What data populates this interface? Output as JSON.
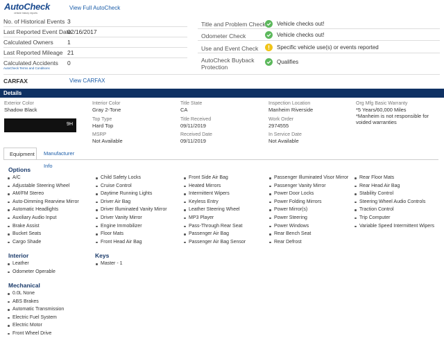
{
  "colors": {
    "accent": "#1a5ca8",
    "details_bar": "#0f3163",
    "check_green": "#5cb85c",
    "check_yellow": "#f0c419"
  },
  "autocheck": {
    "logo_text": "AutoCheck",
    "logo_sub": "vehicle history reports",
    "view_full": "View Full AutoCheck",
    "stats": [
      {
        "label": "No. of Historical Events",
        "value": "3"
      },
      {
        "label": "Last Reported Event Date",
        "value": "02/16/2017"
      },
      {
        "label": "Calculated Owners",
        "value": "1"
      },
      {
        "label": "Last Reported Mileage",
        "value": "21"
      },
      {
        "label": "Calculated Accidents",
        "value": "0"
      }
    ],
    "terms": "AutoCheck Terms and Conditions",
    "checks": [
      {
        "label": "Title and Problem Check",
        "status": "green",
        "icon": "check-circle-icon",
        "text": "Vehicle checks out!"
      },
      {
        "label": "Odometer Check",
        "status": "green",
        "icon": "check-circle-icon",
        "text": "Vehicle checks out!"
      },
      {
        "label": "Use and Event Check",
        "status": "yellow",
        "icon": "alert-circle-icon",
        "text": "Specific vehicle use(s) or events reported"
      },
      {
        "label": "AutoCheck Buyback Protection",
        "status": "green",
        "icon": "check-circle-icon",
        "text": "Qualifies"
      }
    ]
  },
  "carfax": {
    "label": "CARFAX",
    "view_link": "View CARFAX"
  },
  "details": {
    "title": "Details",
    "exterior_color": {
      "label": "Exterior Color",
      "value": "Shadow Black"
    },
    "interior_color": {
      "label": "Interior Color",
      "value": "Gray 2-Tone"
    },
    "top_type": {
      "label": "Top Type",
      "value": "Hard Top"
    },
    "msrp": {
      "label": "MSRP",
      "value": "Not Available"
    },
    "title_state": {
      "label": "Title State",
      "value": "CA"
    },
    "title_received": {
      "label": "Title Received",
      "value": "09/11/2019"
    },
    "received_date": {
      "label": "Received Date",
      "value": "09/11/2019"
    },
    "inspection_location": {
      "label": "Inspection Location",
      "value": "Manheim Riverside"
    },
    "work_order": {
      "label": "Work Order",
      "value": "2974555"
    },
    "in_service_date": {
      "label": "In Service Date",
      "value": "Not Available"
    },
    "warranty": {
      "label": "Org Mfg Basic Warranty",
      "value1": "*5 Years/60,000 Miles",
      "value2": "*Manheim is not responsible for",
      "value3": "voided warranties"
    },
    "vin_suffix": "9H"
  },
  "tabs": [
    {
      "label": "Equipment",
      "active": true
    },
    {
      "label": "Manufacturer Info",
      "active": false
    }
  ],
  "options": {
    "title": "Options",
    "col1": [
      "A/C",
      "Adjustable Steering Wheel",
      "AM/FM Stereo",
      "Auto-Dimming Rearview Mirror",
      "Automatic Headlights",
      "Auxiliary Audio Input",
      "Brake Assist",
      "Bucket Seats",
      "Cargo Shade"
    ],
    "col2": [
      "Child Safety Locks",
      "Cruise Control",
      "Daytime Running Lights",
      "Driver Air Bag",
      "Driver Illuminated Vanity Mirror",
      "Driver Vanity Mirror",
      "Engine Immobilizer",
      "Floor Mats",
      "Front Head Air Bag"
    ],
    "col3": [
      "Front Side Air Bag",
      "Heated Mirrors",
      "Intermittent Wipers",
      "Keyless Entry",
      "Leather Steering Wheel",
      "MP3 Player",
      "Pass-Through Rear Seat",
      "Passenger Air Bag",
      "Passenger Air Bag Sensor"
    ],
    "col4": [
      "Passenger Illuminated Visor Mirror",
      "Passenger Vanity Mirror",
      "Power Door Locks",
      "Power Folding Mirrors",
      "Power Mirror(s)",
      "Power Steering",
      "Power Windows",
      "Rear Bench Seat",
      "Rear Defrost"
    ],
    "col5": [
      "Rear Floor Mats",
      "Rear Head Air Bag",
      "Stability Control",
      "Steering Wheel Audio Controls",
      "Traction Control",
      "Trip Computer",
      "Variable Speed Intermittent Wipers"
    ]
  },
  "interior": {
    "title": "Interior",
    "items": [
      "Leather",
      "Odometer Operable"
    ]
  },
  "keys": {
    "title": "Keys",
    "items": [
      "Master - 1"
    ]
  },
  "mechanical": {
    "title": "Mechanical",
    "items": [
      "0.0L None",
      "ABS Brakes",
      "Automatic Transmission",
      "Electric Fuel System",
      "Electric Motor",
      "Front Wheel Drive"
    ]
  }
}
